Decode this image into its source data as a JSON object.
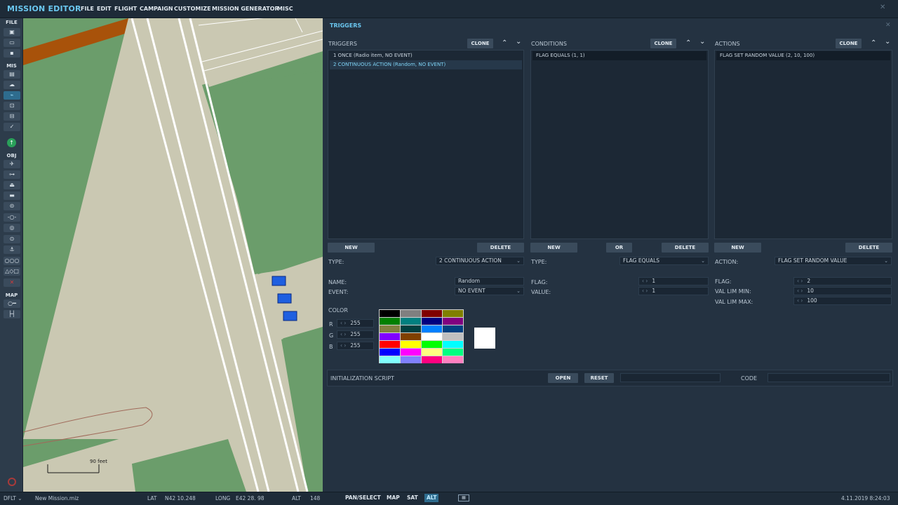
{
  "app_title": "MISSION EDITOR",
  "menu": [
    "FILE",
    "EDIT",
    "FLIGHT",
    "CAMPAIGN",
    "CUSTOMIZE",
    "MISSION GENERATOR",
    "MISC"
  ],
  "close_glyph": "✕",
  "toolbar": {
    "sections": [
      "FILE",
      "MIS",
      "OBJ",
      "MAP"
    ],
    "file_icons": [
      "new-file-icon",
      "open-folder-icon",
      "save-icon"
    ],
    "mis_icons": [
      "briefing-icon",
      "weather-icon",
      "triggers-icon",
      "goals-icon",
      "resources-icon",
      "check-icon",
      "waypoint-icon"
    ],
    "obj_icons": [
      "airplane-icon",
      "helicopter-icon",
      "ship-icon",
      "vehicle-icon",
      "armor-icon",
      "static-object-icon",
      "target-icon",
      "zone-icon",
      "anchor-icon",
      "template-icon",
      "shapes-icon",
      "delete-icon"
    ],
    "map_icons": [
      "ruler-key-icon",
      "measure-icon"
    ]
  },
  "map": {
    "scale_label": "90 feet"
  },
  "panel": {
    "title": "TRIGGERS",
    "triggers": {
      "label": "TRIGGERS",
      "clone": "CLONE",
      "items": [
        "1 ONCE (Radio item, NO EVENT)",
        "2 CONTINUOUS ACTION (Random, NO EVENT)"
      ],
      "selected": 1,
      "new": "NEW",
      "delete": "DELETE",
      "type_label": "TYPE:",
      "type_value": "2 CONTINUOUS ACTION",
      "name_label": "NAME:",
      "name_value": "Random",
      "event_label": "EVENT:",
      "event_value": "NO EVENT",
      "color_label": "COLOR",
      "r_label": "R",
      "r_value": "255",
      "g_label": "G",
      "g_value": "255",
      "b_label": "B",
      "b_value": "255"
    },
    "conditions": {
      "label": "CONDITIONS",
      "clone": "CLONE",
      "items": [
        "FLAG EQUALS (1, 1)"
      ],
      "new": "NEW",
      "or": "OR",
      "delete": "DELETE",
      "type_label": "TYPE:",
      "type_value": "FLAG EQUALS",
      "flag_label": "FLAG:",
      "flag_value": "1",
      "value_label": "VALUE:",
      "value_value": "1"
    },
    "actions": {
      "label": "ACTIONS",
      "clone": "CLONE",
      "items": [
        "FLAG SET RANDOM VALUE (2, 10, 100)"
      ],
      "new": "NEW",
      "delete": "DELETE",
      "action_label": "ACTION:",
      "action_value": "FLAG SET RANDOM VALUE",
      "flag_label": "FLAG:",
      "flag_value": "2",
      "min_label": "VAL LIM MIN:",
      "min_value": "10",
      "max_label": "VAL LIM MAX:",
      "max_value": "100"
    },
    "palette": [
      "#000000",
      "#808080",
      "#800000",
      "#808000",
      "#008000",
      "#008080",
      "#000080",
      "#800080",
      "#808040",
      "#004040",
      "#0080ff",
      "#004080",
      "#8000ff",
      "#804000",
      "#ffffff",
      "#c0c0c0",
      "#ff0000",
      "#ffff00",
      "#00ff00",
      "#00ffff",
      "#0000ff",
      "#ff00ff",
      "#ffff80",
      "#00ff80",
      "#80ffff",
      "#8080ff",
      "#ff0080",
      "#ff80c0"
    ],
    "preview_color": "#ffffff",
    "init_script": {
      "label": "INITIALIZATION SCRIPT",
      "open": "OPEN",
      "reset": "RESET",
      "code_label": "CODE"
    }
  },
  "status": {
    "profile": "DFLT",
    "mission_file": "New Mission.miz",
    "lat_label": "LAT",
    "lat_value": "N42 10.248",
    "long_label": "LONG",
    "long_value": "E42 28. 98",
    "alt_label": "ALT",
    "alt_value": "148",
    "modes": [
      "PAN/SELECT",
      "MAP",
      "SAT",
      "ALT"
    ],
    "active_mode": 3,
    "datetime": "4.11.2019 8:24:03"
  }
}
